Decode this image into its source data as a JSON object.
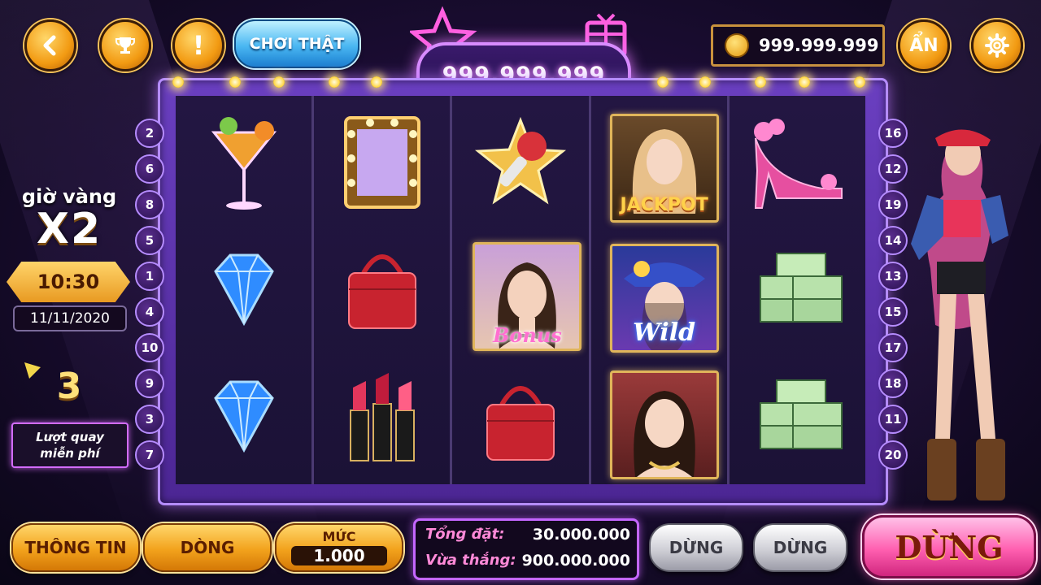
{
  "top_bar": {
    "play_real_label": "CHƠI THẬT",
    "jackpot_value": "999.999.999",
    "balance": "999.999.999",
    "hide_label": "ẨN",
    "exclaim": "!"
  },
  "left_panel": {
    "golden_hour_label": "giờ vàng",
    "multiplier": "X2",
    "time": "10:30",
    "date": "11/11/2020",
    "free_spins_count": "3",
    "free_spins_label_line1": "Lượt quay",
    "free_spins_label_line2": "miễn phí"
  },
  "paylines_left": [
    "2",
    "6",
    "8",
    "5",
    "1",
    "4",
    "10",
    "9",
    "3",
    "7"
  ],
  "paylines_right": [
    "16",
    "12",
    "19",
    "14",
    "13",
    "15",
    "17",
    "18",
    "11",
    "20"
  ],
  "reels": [
    [
      "cocktail",
      "diamond",
      "diamond"
    ],
    [
      "mirror",
      "red-handbag",
      "lipstick"
    ],
    [
      "star-microphone",
      "bonus-girl",
      "red-handbag"
    ],
    [
      "jackpot-girl",
      "wild-girl",
      "lady-portrait"
    ],
    [
      "high-heel",
      "money-stack",
      "money-stack"
    ]
  ],
  "symbol_labels": {
    "jackpot": "JACKPOT",
    "bonus": "Bonus",
    "wild": "Wild"
  },
  "bottom_bar": {
    "info_label": "THÔNG TIN",
    "lines_label": "DÒNG",
    "level_label": "MỨC",
    "level_value": "1.000",
    "total_bet_label": "Tổng đặt:",
    "total_bet_value": "30.000.000",
    "win_label": "Vừa thắng:",
    "win_value": "900.000.000",
    "stop_label_1": "DỪNG",
    "stop_label_2": "DỪNG",
    "stop_main_label": "DỪNG"
  },
  "colors": {
    "accent_gold": "#f2a21c",
    "accent_purple": "#b58cff",
    "spin_pink": "#ff5fb0"
  }
}
